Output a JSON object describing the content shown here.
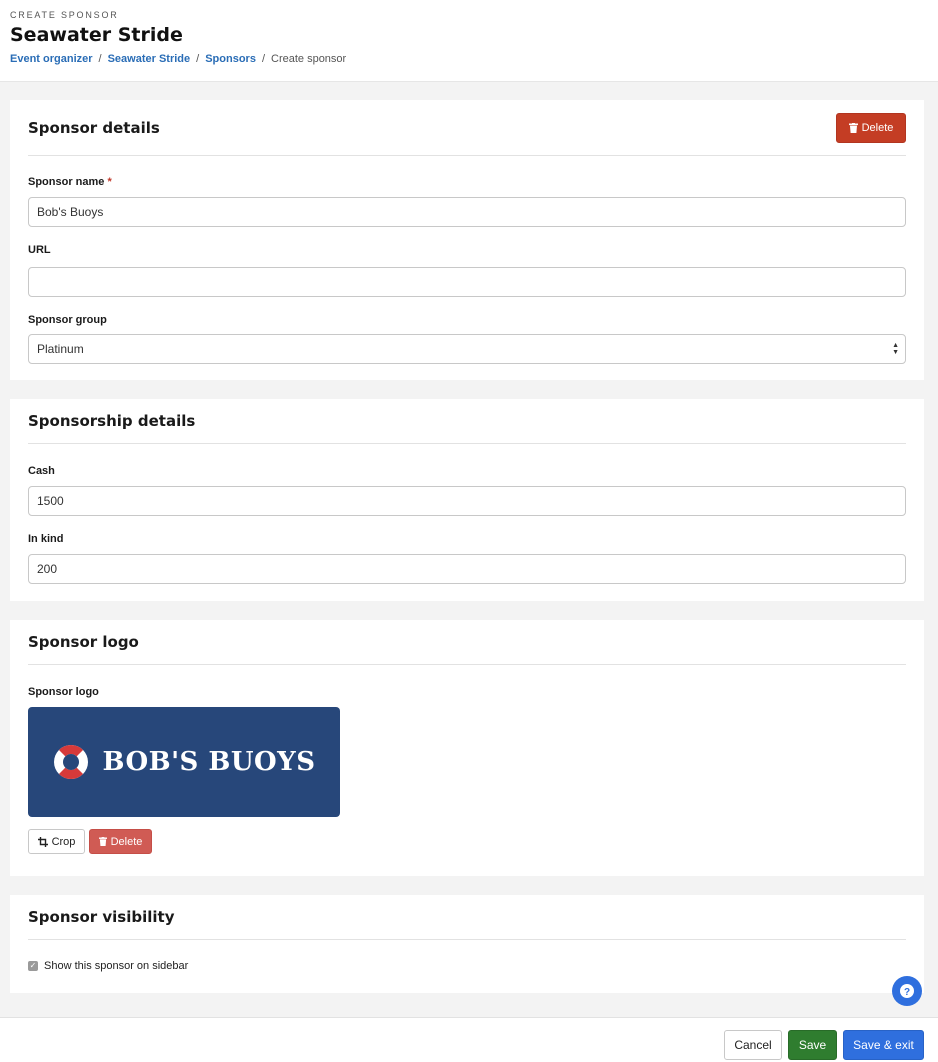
{
  "header": {
    "eyebrow": "CREATE SPONSOR",
    "title": "Seawater Stride",
    "breadcrumb": [
      "Event organizer",
      "Seawater Stride",
      "Sponsors"
    ],
    "breadcrumb_current": "Create sponsor"
  },
  "sponsor_details": {
    "title": "Sponsor details",
    "delete_label": "Delete",
    "name_label": "Sponsor name",
    "name_required": "*",
    "name_value": "Bob's Buoys",
    "url_label": "URL",
    "url_value": "",
    "group_label": "Sponsor group",
    "group_value": "Platinum"
  },
  "sponsorship_details": {
    "title": "Sponsorship details",
    "cash_label": "Cash",
    "cash_value": "1500",
    "inkind_label": "In kind",
    "inkind_value": "200"
  },
  "sponsor_logo": {
    "title": "Sponsor logo",
    "field_label": "Sponsor logo",
    "logo_text": "BOB'S BUOYS",
    "crop_label": "Crop",
    "delete_label": "Delete"
  },
  "sponsor_visibility": {
    "title": "Sponsor visibility",
    "checkbox_label": "Show this sponsor on sidebar",
    "checked": true
  },
  "footer": {
    "cancel_label": "Cancel",
    "save_label": "Save",
    "save_exit_label": "Save & exit"
  },
  "colors": {
    "danger": "#c43d24",
    "success": "#2f7d2f",
    "primary": "#2f6fde",
    "link": "#2a6db6",
    "logo_bg": "#27477a"
  }
}
